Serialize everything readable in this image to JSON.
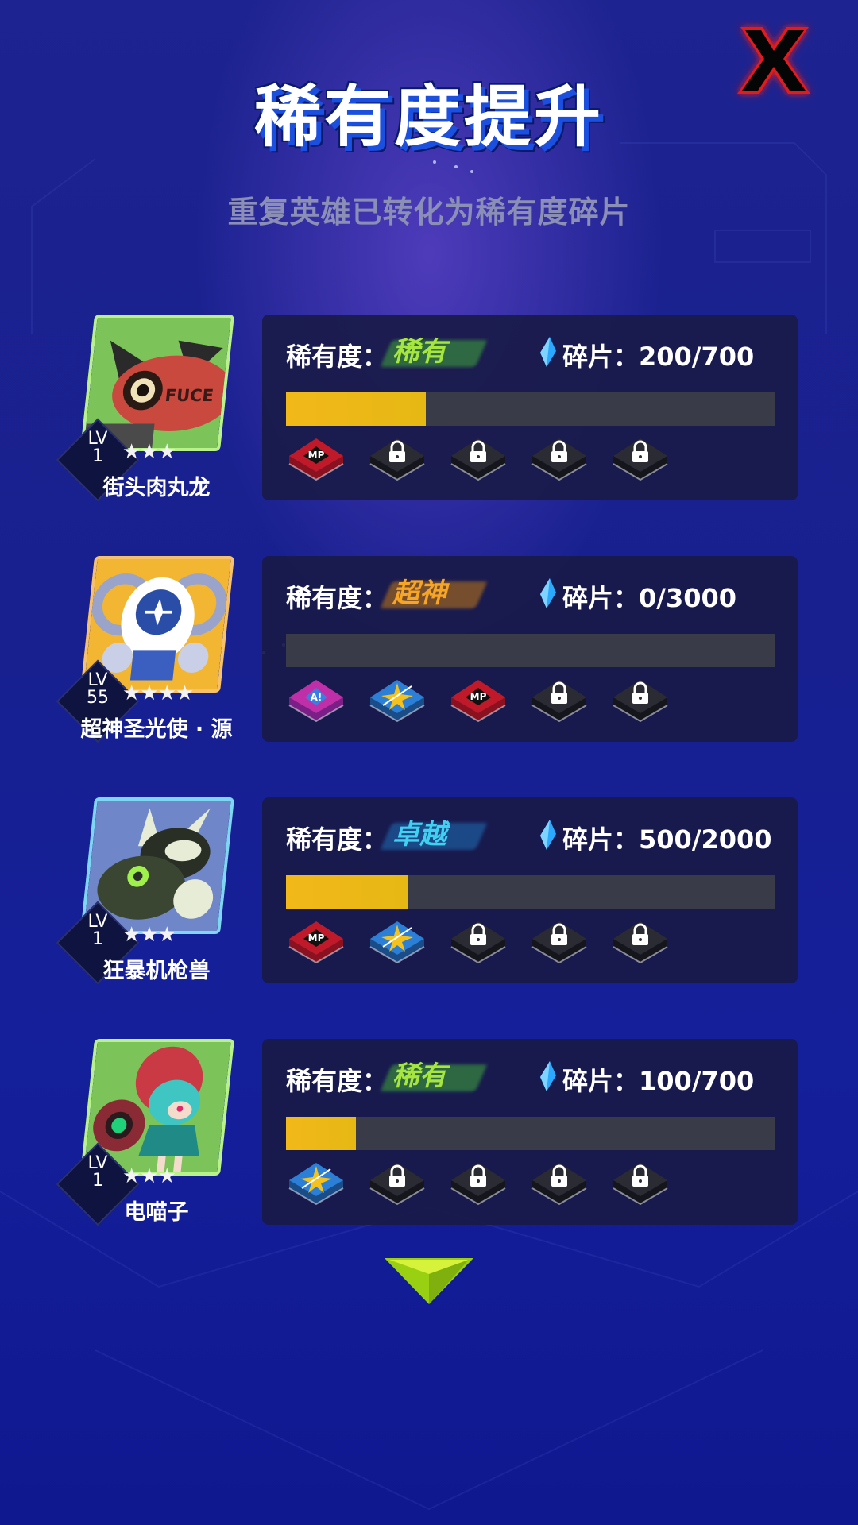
{
  "header": {
    "title": "稀有度提升",
    "subtitle": "重复英雄已转化为稀有度碎片",
    "close_icon": "close-x-icon"
  },
  "colors": {
    "rare": "#9ce23a",
    "legendary": "#f6a524",
    "epic": "#3fd0f2",
    "progress": "#f2b81a",
    "track": "#3a3b48"
  },
  "heroes": [
    {
      "name": "街头肉丸龙",
      "lv_label": "LV",
      "level": "1",
      "stars": "★★★",
      "rarity_label": "稀有度：",
      "rarity": "稀有",
      "rarity_tier": "rare",
      "shards_label": "碎片：",
      "shards": "200/700",
      "progress": 0.2857,
      "badges": [
        "mp-badge",
        "lock",
        "lock",
        "lock",
        "lock"
      ]
    },
    {
      "name": "超神圣光使 · 源",
      "lv_label": "LV",
      "level": "55",
      "stars": "★★★★",
      "rarity_label": "稀有度：",
      "rarity": "超神",
      "rarity_tier": "legendary",
      "shards_label": "碎片：",
      "shards": "0/3000",
      "progress": 0,
      "badges": [
        "atk-badge",
        "star-badge",
        "mp-badge",
        "lock",
        "lock"
      ]
    },
    {
      "name": "狂暴机枪兽",
      "lv_label": "LV",
      "level": "1",
      "stars": "★★★",
      "rarity_label": "稀有度：",
      "rarity": "卓越",
      "rarity_tier": "epic",
      "shards_label": "碎片：",
      "shards": "500/2000",
      "progress": 0.25,
      "badges": [
        "mp-badge",
        "star-badge",
        "lock",
        "lock",
        "lock"
      ]
    },
    {
      "name": "电喵子",
      "lv_label": "LV",
      "level": "1",
      "stars": "★★★",
      "rarity_label": "稀有度：",
      "rarity": "稀有",
      "rarity_tier": "rare",
      "shards_label": "碎片：",
      "shards": "100/700",
      "progress": 0.1429,
      "badges": [
        "star-badge",
        "lock",
        "lock",
        "lock",
        "lock"
      ]
    }
  ],
  "footer": {
    "scroll_icon": "chevron-down-icon"
  }
}
